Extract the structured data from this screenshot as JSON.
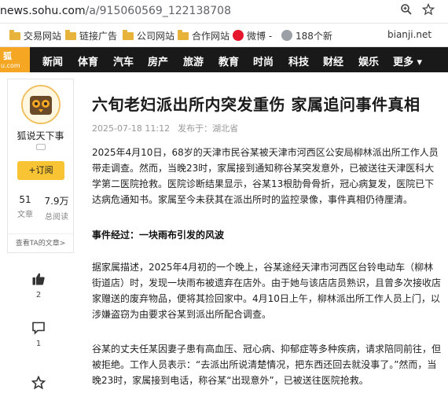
{
  "browser": {
    "url_domain": "news.sohu.com",
    "url_path": "/a/915060569_122138708"
  },
  "bookmarks": [
    {
      "label": "交易网站",
      "icon": "folder-icon"
    },
    {
      "label": "链接广告",
      "icon": "folder-icon"
    },
    {
      "label": "公司网站",
      "icon": "folder-icon"
    },
    {
      "label": "合作网站",
      "icon": "folder-icon"
    },
    {
      "label": "微博 -",
      "icon": "weibo-icon"
    },
    {
      "label": "188个新",
      "icon": "site-icon"
    },
    {
      "label": "bianji.net",
      "icon": ""
    }
  ],
  "nav": {
    "logo_top": "狐",
    "logo_bottom": "u.com",
    "items": [
      "新闻",
      "体育",
      "汽车",
      "房产",
      "旅游",
      "教育",
      "时尚",
      "科技",
      "财经",
      "娱乐",
      "更多 ▾"
    ]
  },
  "author": {
    "name": "狐说天下事",
    "follow_label": "+订阅",
    "articles_count": "51",
    "articles_label": "文章",
    "reads_count": "7.9万",
    "reads_label": "总阅读",
    "more_label": "查看TA的文章>"
  },
  "actions": {
    "like_count": "2",
    "comment_count": "1"
  },
  "article": {
    "title": "六旬老妇派出所内突发重伤 家属追问事件真相",
    "date": "2025-07-18 11:12",
    "location": "发布于：湖北省",
    "p1": "2025年4月10日，68岁的天津市民谷某被天津市河西区公安局柳林派出所工作人员带走调查。然而，当晚23时，家属接到通知称谷某突发意外，已被送往天津医科大学第二医院抢救。医院诊断结果显示，谷某13根肋骨骨折，冠心病复发，医院已下达病危通知书。家属至今未获其在派出所时的监控录像，事件真相仍待厘清。",
    "subheading": "事件经过：一块雨布引发的风波",
    "p2": "据家属描述，2025年4月初的一个晚上，谷某途经天津市河西区台铃电动车（柳林街道店）时，发现一块雨布被遗弃在店外。由于她与该店店员熟识，且曾多次接收店家赠送的废弃物品，便将其捡回家中。4月10日上午，柳林派出所工作人员上门，以涉嫌盗窃为由要求谷某到派出所配合调查。",
    "p3": "谷某的丈夫任某因妻子患有高血压、冠心病、抑郁症等多种疾病，请求陪同前往，但被拒绝。工作人员表示：“去派出所说清楚情况，把东西还回去就没事了。”然而，当晚23时，家属接到电话，称谷某“出现意外”，已被送往医院抢救。"
  }
}
